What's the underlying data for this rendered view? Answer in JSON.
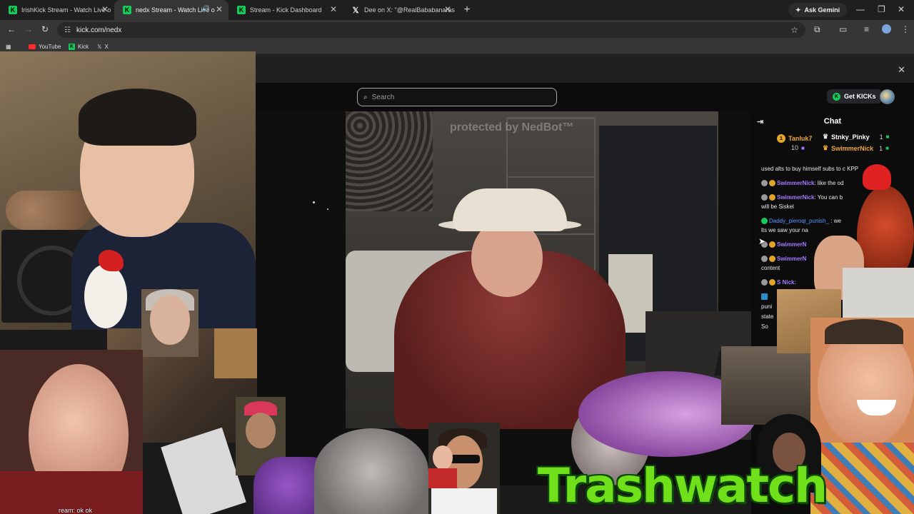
{
  "browser": {
    "tabs": [
      {
        "title": "IrishKick Stream - Watch Live o",
        "favicon": "kick-icon",
        "active": false
      },
      {
        "title": "nedx Stream - Watch Live o",
        "favicon": "kick-icon",
        "active": true,
        "playing_audio": true
      },
      {
        "title": "Stream - Kick Dashboard",
        "favicon": "kick-icon",
        "active": false
      },
      {
        "title": "Dee on X: \"@RealBababanaras",
        "favicon": "x-icon",
        "active": false
      }
    ],
    "new_tab": "+",
    "ask_gemini": "Ask Gemini",
    "url": "kick.com/nedx",
    "bookmarks": [
      {
        "label": "YouTube",
        "icon": "youtube-icon"
      },
      {
        "label": "Kick",
        "icon": "kick-icon"
      },
      {
        "label": "X",
        "icon": "x-icon"
      }
    ]
  },
  "kick": {
    "search_placeholder": "Search",
    "get_kicks": "Get KICKs",
    "video_watermark": "protected by NedBot™"
  },
  "chat": {
    "title": "Chat",
    "leaderboard": [
      {
        "name": "Tanluk7",
        "count": "10"
      },
      {
        "name": "Stnky_Pinky",
        "count": "1"
      },
      {
        "name": "SwimmerNick",
        "count": "1"
      }
    ],
    "messages": [
      {
        "user": "",
        "text": "used alts to buy himself subs to c",
        "trail": "KPP"
      },
      {
        "user": "SwimmerNick",
        "text": "like the od"
      },
      {
        "user": "SwimmerNick",
        "text": "You can b",
        "cont": "will be Siskel"
      },
      {
        "user": "Daddy_pieroqi_punish_",
        "text": "we",
        "cont": "lts we saw your na"
      },
      {
        "user": "SwimmerN",
        "text": ""
      },
      {
        "user": "SwimmerN",
        "text": "",
        "cont": "content"
      },
      {
        "user": "S",
        "text": "Nick:"
      },
      {
        "user": "",
        "text": "",
        "cont": "puni"
      },
      {
        "user": "",
        "text": "",
        "cont": "state"
      },
      {
        "user": "",
        "text": "",
        "cont": "So"
      }
    ]
  },
  "overlay": {
    "title_graphic": "Trashwatch",
    "caption": "ream: ok ok"
  },
  "colors": {
    "kick_green": "#16c95b",
    "chat_user_purple": "#a479ff",
    "chat_user_blue": "#5f94ff",
    "trashwatch_green": "#6fe01a"
  }
}
